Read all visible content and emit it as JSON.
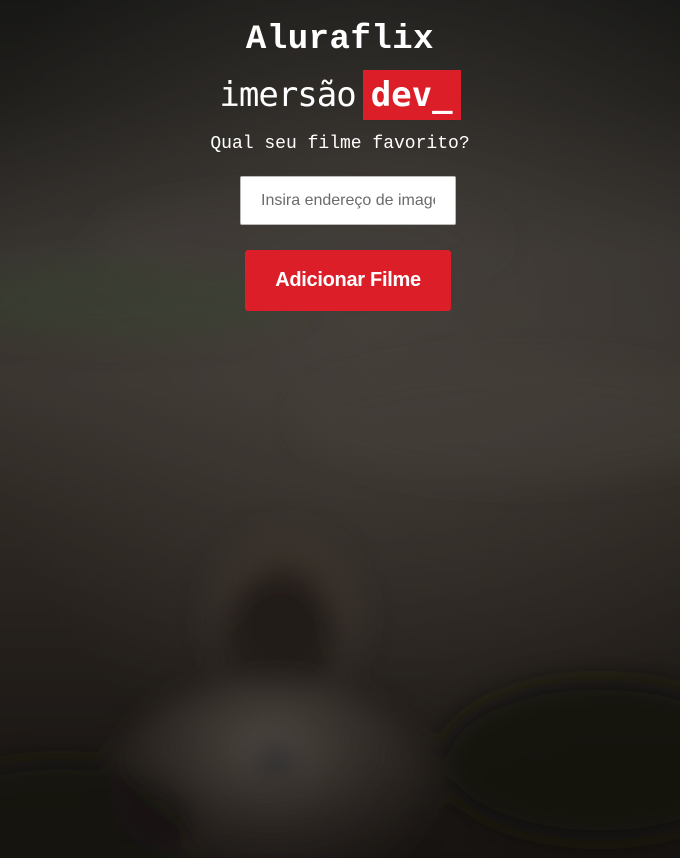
{
  "header": {
    "title": "Aluraflix",
    "subtitle_plain": "imersão",
    "subtitle_highlight": "dev_"
  },
  "form": {
    "prompt": "Qual seu filme favorito?",
    "input_placeholder": "Insira endereço de imagem",
    "input_value": "",
    "submit_label": "Adicionar Filme"
  },
  "colors": {
    "accent": "#dc1e28",
    "text": "#ffffff",
    "background_dark": "#2a2724"
  }
}
